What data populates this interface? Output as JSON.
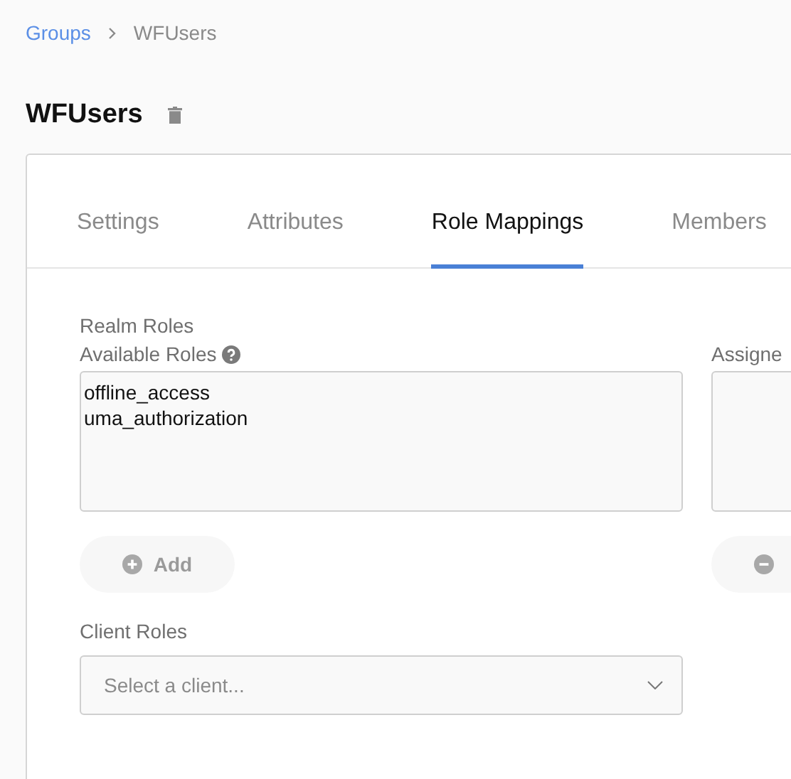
{
  "breadcrumb": [
    {
      "label": "Groups",
      "link": true
    },
    {
      "label": "WFUsers",
      "link": false
    }
  ],
  "title": "WFUsers",
  "tabs": [
    {
      "label": "Settings",
      "selected": false
    },
    {
      "label": "Attributes",
      "selected": false
    },
    {
      "label": "Role Mappings",
      "selected": true
    },
    {
      "label": "Members",
      "selected": false
    }
  ],
  "realm_roles": {
    "heading": "Realm Roles",
    "available_label": "Available Roles",
    "available_roles": [
      "offline_access",
      "uma_authorization"
    ],
    "add_button": "Add",
    "assigned_label": "Assigne"
  },
  "client_roles": {
    "label": "Client Roles",
    "placeholder": "Select a client..."
  }
}
